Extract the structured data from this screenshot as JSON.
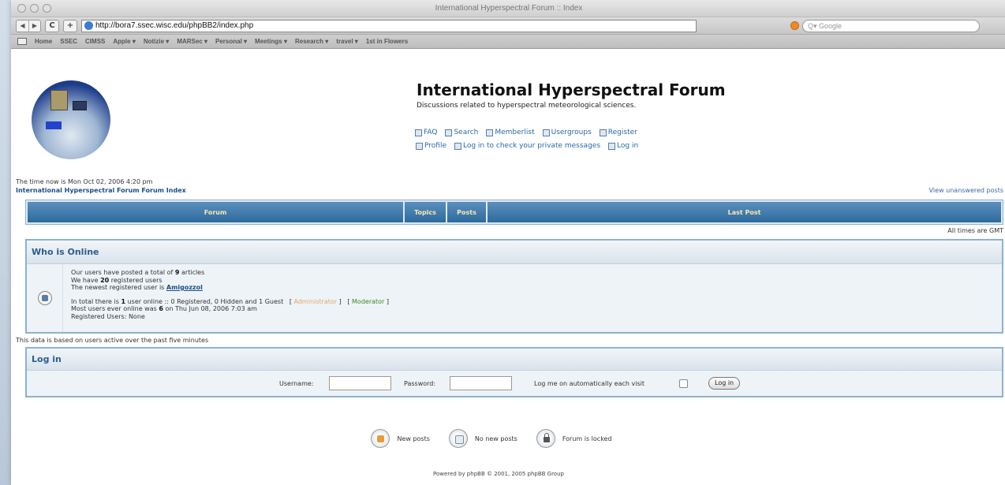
{
  "browser": {
    "window_title": "International Hyperspectral Forum :: Index",
    "url": "http://bora7.ssec.wisc.edu/phpBB2/index.php",
    "search_placeholder": "Google",
    "bookmarks": [
      "Home",
      "SSEC",
      "CIMSS",
      "Apple ▾",
      "Notizie ▾",
      "MARSec ▾",
      "Personal ▾",
      "Meetings ▾",
      "Research ▾",
      "travel ▾",
      "1st in Flowers"
    ]
  },
  "header": {
    "title": "International Hyperspectral Forum",
    "description": "Discussions related to hyperspectral meteorological sciences.",
    "nav_row1": [
      "FAQ",
      "Search",
      "Memberlist",
      "Usergroups",
      "Register"
    ],
    "nav_row2": [
      "Profile",
      "Log in to check your private messages",
      "Log in"
    ]
  },
  "page": {
    "time_now": "The time now is Mon Oct 02, 2006 4:20 pm",
    "breadcrumb": "International Hyperspectral Forum Forum Index",
    "view_unanswered": "View unanswered posts",
    "all_times": "All times are GMT",
    "data_based": "This data is based on users active over the past five minutes"
  },
  "forum_table": {
    "headers": [
      "Forum",
      "Topics",
      "Posts",
      "Last Post"
    ]
  },
  "who_is_online": {
    "heading": "Who is Online",
    "line1_pre": "Our users have posted a total of ",
    "line1_num": "9",
    "line1_post": " articles",
    "line2_pre": "We have ",
    "line2_num": "20",
    "line2_post": " registered users",
    "line3_pre": "The newest registered user is ",
    "newest_user": "Amigozzol",
    "line4_pre": "In total there is ",
    "line4_num": "1",
    "line4_post": " user online :: 0 Registered, 0 Hidden and 1 Guest   [ ",
    "administrator": "Administrator",
    "mid_bracket": " ]   [ ",
    "moderator": "Moderator",
    "end_bracket": " ]",
    "line5_pre": "Most users ever online was ",
    "line5_num": "6",
    "line5_post": " on Thu Jun 08, 2006 7:03 am",
    "line6": "Registered Users: None"
  },
  "login": {
    "heading": "Log in",
    "username_label": "Username:",
    "password_label": "Password:",
    "auto_label": "Log me on automatically each visit",
    "button": "Log in"
  },
  "legend": {
    "new_posts": "New posts",
    "no_new_posts": "No new posts",
    "locked": "Forum is locked"
  },
  "footer": {
    "powered": "Powered by phpBB © 2001, 2005 phpBB Group"
  }
}
